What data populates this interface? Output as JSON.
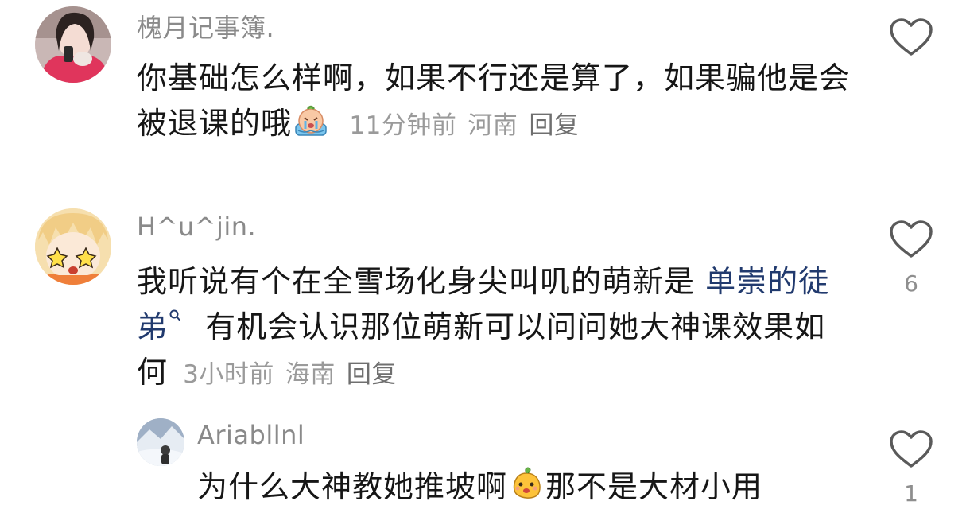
{
  "comments": [
    {
      "author": "槐月记事簿.",
      "text": "你基础怎么样啊，如果不行还是算了，如果骗他是会被退课的哦",
      "emoji": "crying-emoji",
      "time": "11分钟前",
      "location": "河南",
      "reply_label": "回复",
      "like_count": ""
    },
    {
      "author": "H^u^jin.",
      "text_before_link": "我听说有个在全雪场化身尖叫叽的萌新是 ",
      "link_text": "单崇的徒弟",
      "text_after_link": " 有机会认识那位萌新可以问问她大神课效果如何",
      "time": "3小时前",
      "location": "海南",
      "reply_label": "回复",
      "like_count": "6"
    },
    {
      "author": "Ariabllnl",
      "text_before_emoji": "为什么大神教她推坡啊",
      "emoji": "mango-emoji",
      "text_after_emoji": "那不是大材小用",
      "like_count": "1"
    }
  ],
  "colors": {
    "link": "#213a6e",
    "meta": "#9a9a9a",
    "author": "#8a8a8a"
  }
}
